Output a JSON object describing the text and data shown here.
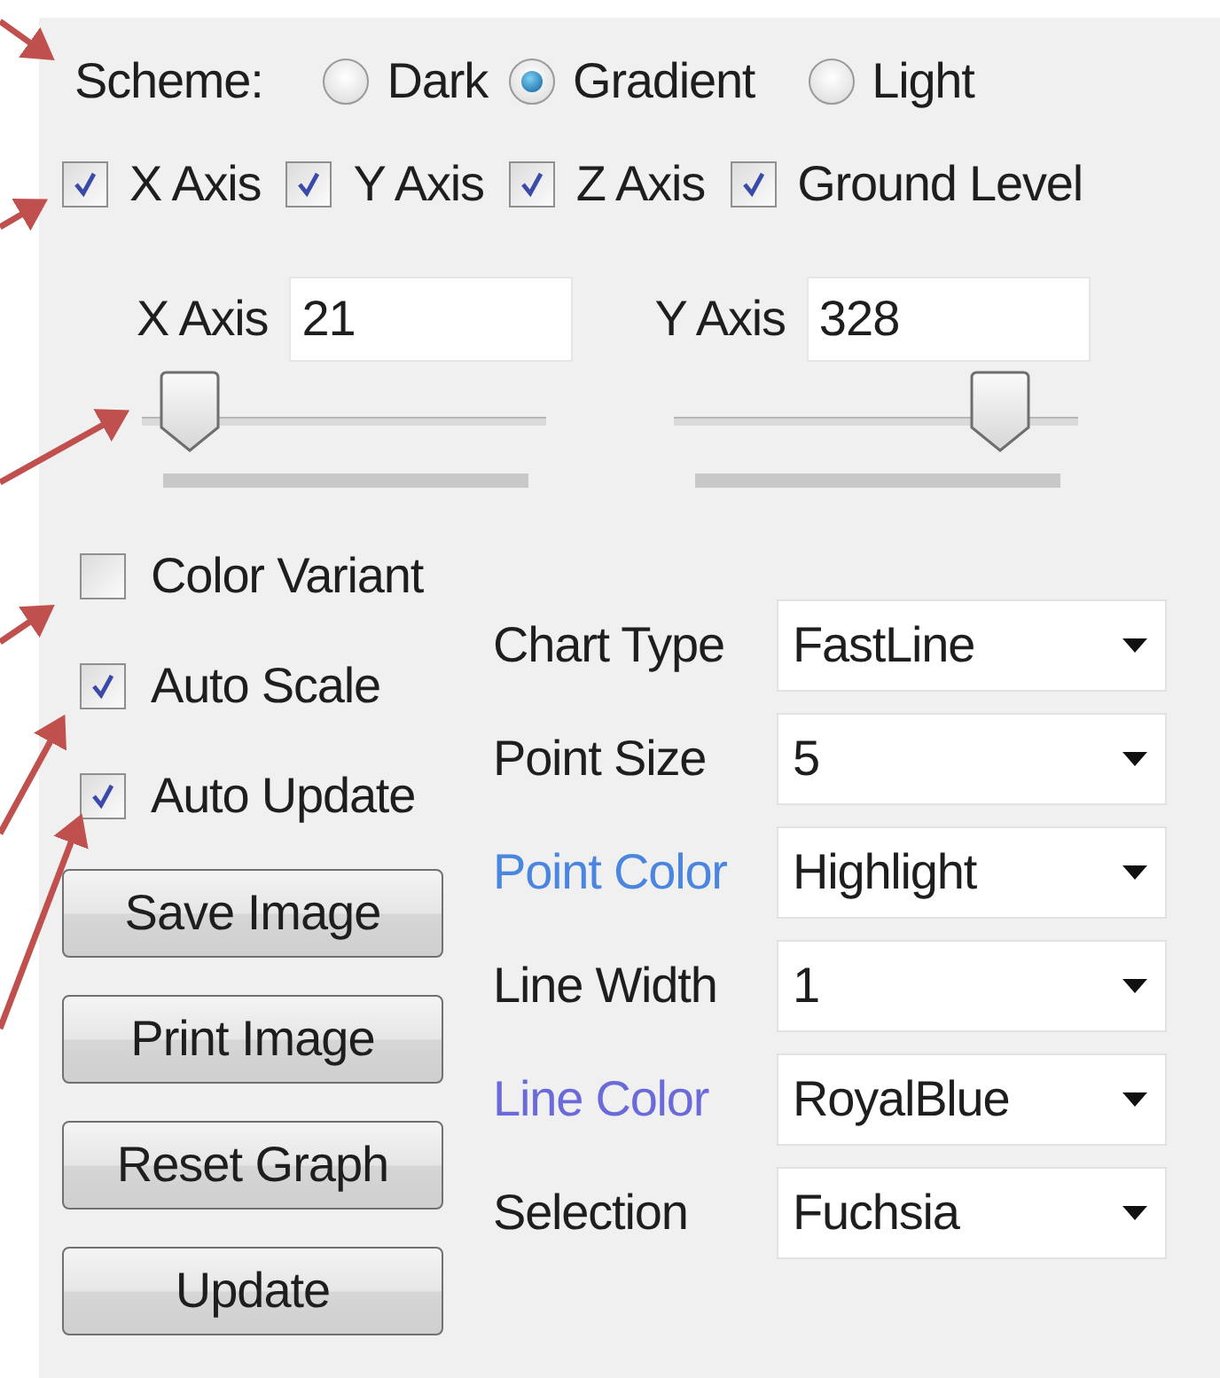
{
  "scheme": {
    "label": "Scheme:",
    "options": [
      {
        "label": "Dark",
        "selected": false
      },
      {
        "label": "Gradient",
        "selected": true
      },
      {
        "label": "Light",
        "selected": false
      }
    ]
  },
  "axes": [
    {
      "label": "X Axis",
      "checked": true
    },
    {
      "label": "Y Axis",
      "checked": true
    },
    {
      "label": "Z Axis",
      "checked": true
    },
    {
      "label": "Ground Level",
      "checked": true
    }
  ],
  "ranges": [
    {
      "label": "X Axis",
      "value": "21",
      "level": 0.05
    },
    {
      "label": "Y Axis",
      "value": "328",
      "level": 0.86
    }
  ],
  "options": [
    {
      "label": "Color Variant",
      "checked": false
    },
    {
      "label": "Auto Scale",
      "checked": true
    },
    {
      "label": "Auto Update",
      "checked": true
    }
  ],
  "buttons": [
    "Save Image",
    "Print Image",
    "Reset Graph",
    "Update"
  ],
  "settings": [
    {
      "label": "Chart Type",
      "value": "FastLine",
      "color": "#1e1e1e"
    },
    {
      "label": "Point Size",
      "value": "5",
      "color": "#1e1e1e"
    },
    {
      "label": "Point Color",
      "value": "Highlight",
      "color": "#4a86e0"
    },
    {
      "label": "Line Width",
      "value": "1",
      "color": "#1e1e1e"
    },
    {
      "label": "Line Color",
      "value": "RoyalBlue",
      "color": "#6a6ad8"
    },
    {
      "label": "Selection",
      "value": "Fuchsia",
      "color": "#1e1e1e"
    }
  ]
}
